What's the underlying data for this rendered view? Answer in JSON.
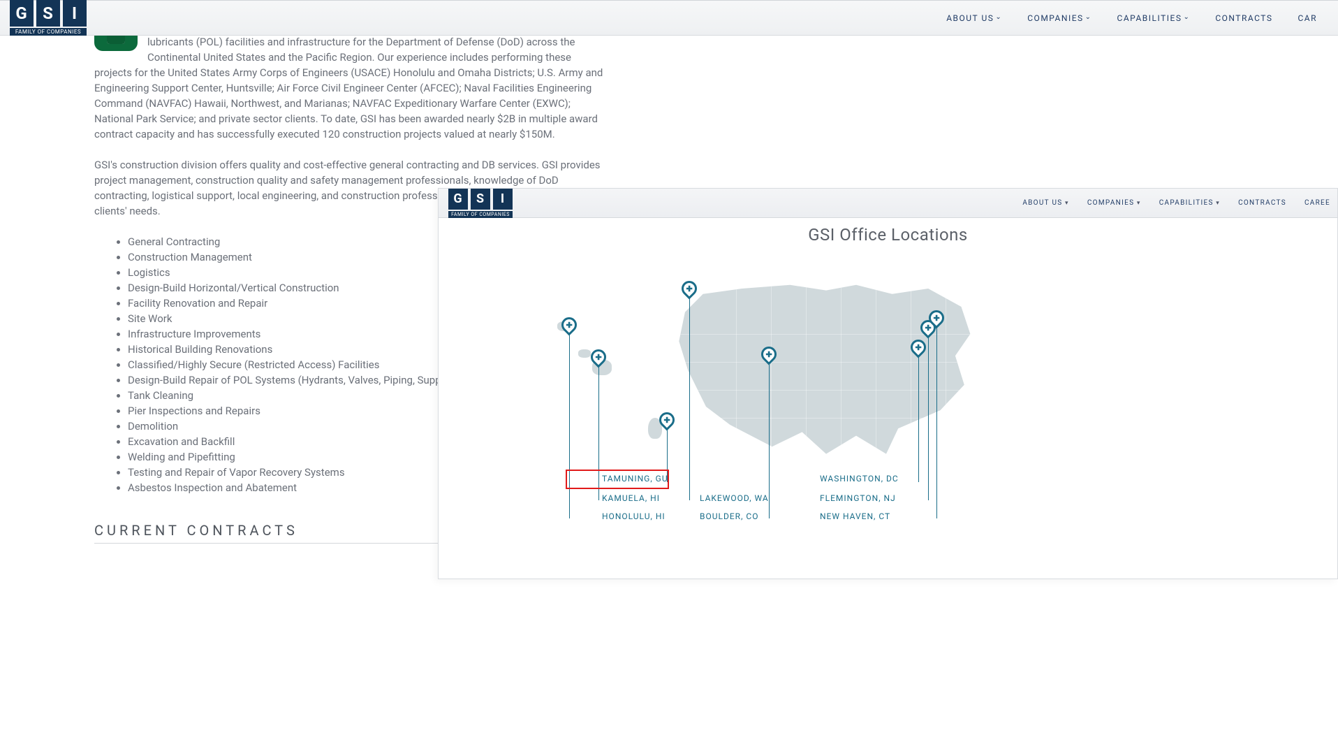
{
  "brand": {
    "letters": [
      "G",
      "S",
      "I"
    ],
    "tagline": "FAMILY OF COMPANIES"
  },
  "nav1": {
    "about": "ABOUT US",
    "companies": "COMPANIES",
    "capabilities": "CAPABILITIES",
    "contracts": "CONTRACTS",
    "careers_cut": "CAR"
  },
  "main": {
    "para1": "GSI has successfully performed both design-build (DB) and design-bid-build (DBB) projects for horizontal and vertical construction and renovation, including work/tasks for petroleum, oil, and lubricants (POL) facilities and infrastructure for the Department of Defense (DoD) across the Continental United States and the Pacific Region. Our experience includes performing these projects for the United States Army Corps of Engineers (USACE) Honolulu and Omaha Districts; U.S. Army and Engineering Support Center, Huntsville; Air Force Civil Engineer Center (AFCEC); Naval Facilities Engineering Command (NAVFAC) Hawaii, Northwest, and Marianas; NAVFAC Expeditionary Warfare Center (EXWC); National Park Service; and private sector clients. To date, GSI has been awarded nearly $2B in multiple award contract capacity and has successfully executed 120 construction projects valued at nearly $150M.",
    "para2": "GSI's construction division offers quality and cost-effective general contracting and DB services. GSI provides project management, construction quality and safety management professionals, knowledge of DoD contracting, logistical support, local engineering, and construction professionals for any project to meet our clients' needs.",
    "bullets": [
      "General Contracting",
      "Construction Management",
      "Logistics",
      "Design-Build Horizontal/Vertical Construction",
      "Facility Renovation and Repair",
      "Site Work",
      "Infrastructure Improvements",
      "Historical Building Renovations",
      "Classified/Highly Secure (Restricted Access) Facilities",
      "Design-Build Repair of POL Systems (Hydrants, Valves, Piping, Supports, Etc.)",
      "Tank Cleaning",
      "Pier Inspections and Repairs",
      "Demolition",
      "Excavation and Backfill",
      "Welding and Pipefitting",
      "Testing and Repair of Vapor Recovery Systems",
      "Asbestos Inspection and Abatement"
    ],
    "section_heading": "CURRENT CONTRACTS"
  },
  "overlay": {
    "nav2": {
      "about": "ABOUT US",
      "companies": "COMPANIES",
      "capabilities": "CAPABILITIES",
      "contracts": "CONTRACTS",
      "careers_cut": "CAREE"
    },
    "title": "GSI Office Locations",
    "locations": {
      "tamuning": "TAMUNING, GU",
      "kamuela": "KAMUELA, HI",
      "honolulu": "HONOLULU, HI",
      "lakewood": "LAKEWOOD, WA",
      "boulder": "BOULDER, CO",
      "washington": "WASHINGTON, DC",
      "flemington": "FLEMINGTON, NJ",
      "newhaven": "NEW HAVEN, CT"
    }
  }
}
